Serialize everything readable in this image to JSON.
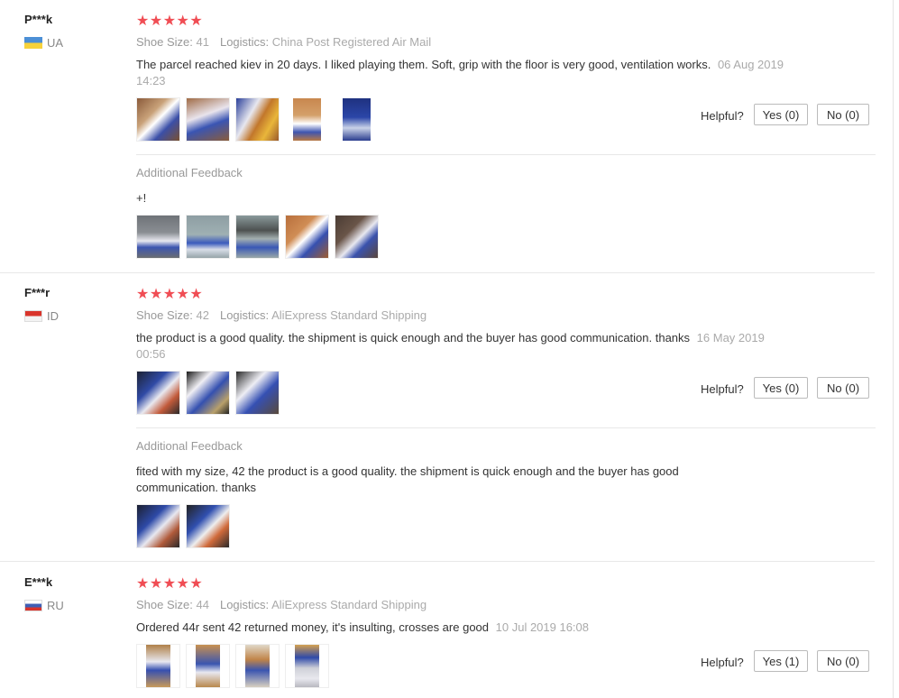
{
  "reviews": [
    {
      "user": "P***k",
      "country": "UA",
      "stars": "★★★★★",
      "size_label": "Shoe Size:",
      "size": "41",
      "logistics_label": "Logistics:",
      "logistics": "China Post Registered Air Mail",
      "text": "The parcel reached kiev in 20 days. I liked playing them. Soft, grip with the floor is very good, ventilation works.",
      "date": "06 Aug 2019 14:23",
      "helpful_label": "Helpful?",
      "yes": "Yes (0)",
      "no": "No (0)",
      "additional_label": "Additional Feedback",
      "additional_text": "+!"
    },
    {
      "user": "F***r",
      "country": "ID",
      "stars": "★★★★★",
      "size_label": "Shoe Size:",
      "size": "42",
      "logistics_label": "Logistics:",
      "logistics": "AliExpress Standard Shipping",
      "text": "the product is a good quality. the shipment is quick enough and the buyer has good communication. thanks",
      "date": "16 May 2019 00:56",
      "helpful_label": "Helpful?",
      "yes": "Yes (0)",
      "no": "No (0)",
      "additional_label": "Additional Feedback",
      "additional_text": "fited with my size, 42 the product is a good quality. the shipment is quick enough and the buyer has good communication. thanks"
    },
    {
      "user": "E***k",
      "country": "RU",
      "stars": "★★★★★",
      "size_label": "Shoe Size:",
      "size": "44",
      "logistics_label": "Logistics:",
      "logistics": "AliExpress Standard Shipping",
      "text": "Ordered 44r sent 42 returned money, it's insulting, crosses are good",
      "date": "10 Jul 2019 16:08",
      "helpful_label": "Helpful?",
      "yes": "Yes (1)",
      "no": "No (0)"
    }
  ],
  "colors": {
    "stars": "#f04d54",
    "meta": "#999999",
    "border": "#e8e8e8"
  }
}
